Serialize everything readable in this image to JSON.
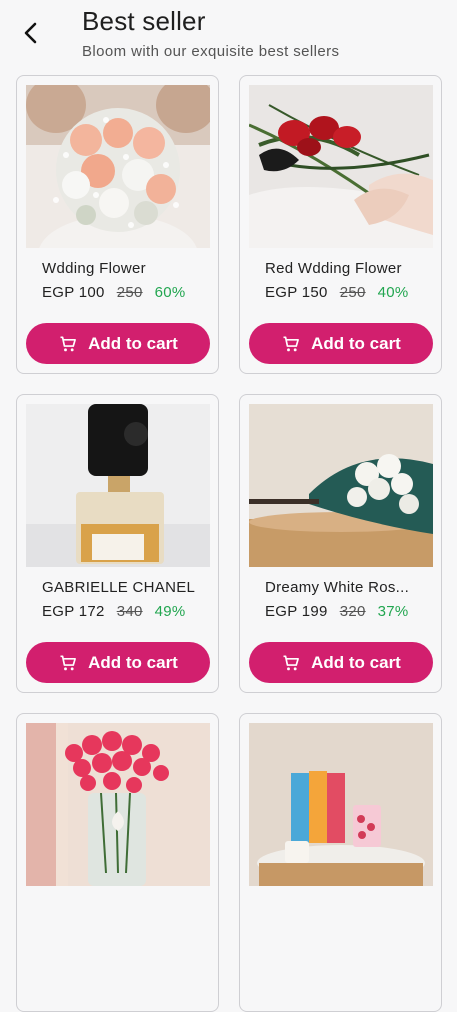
{
  "header": {
    "title": "Best seller",
    "subtitle": "Bloom with our exquisite best sellers"
  },
  "products": [
    {
      "name": "Wdding Flower",
      "price": "EGP 100",
      "old_price": "250",
      "discount": "60%",
      "cart_label": "Add to cart"
    },
    {
      "name": "Red Wdding Flower",
      "price": "EGP 150",
      "old_price": "250",
      "discount": "40%",
      "cart_label": "Add to cart"
    },
    {
      "name": "GABRIELLE CHANEL",
      "price": "EGP 172",
      "old_price": "340",
      "discount": "49%",
      "cart_label": "Add to cart"
    },
    {
      "name": "Dreamy White Ros...",
      "price": "EGP 199",
      "old_price": "320",
      "discount": "37%",
      "cart_label": "Add to cart"
    },
    {
      "name": "",
      "price": "",
      "old_price": "",
      "discount": "",
      "cart_label": ""
    },
    {
      "name": "",
      "price": "",
      "old_price": "",
      "discount": "",
      "cart_label": ""
    }
  ],
  "icons": {
    "back": "arrow-left-icon",
    "cart": "cart-icon"
  },
  "colors": {
    "accent": "#d21f6e",
    "discount": "#22a650"
  }
}
